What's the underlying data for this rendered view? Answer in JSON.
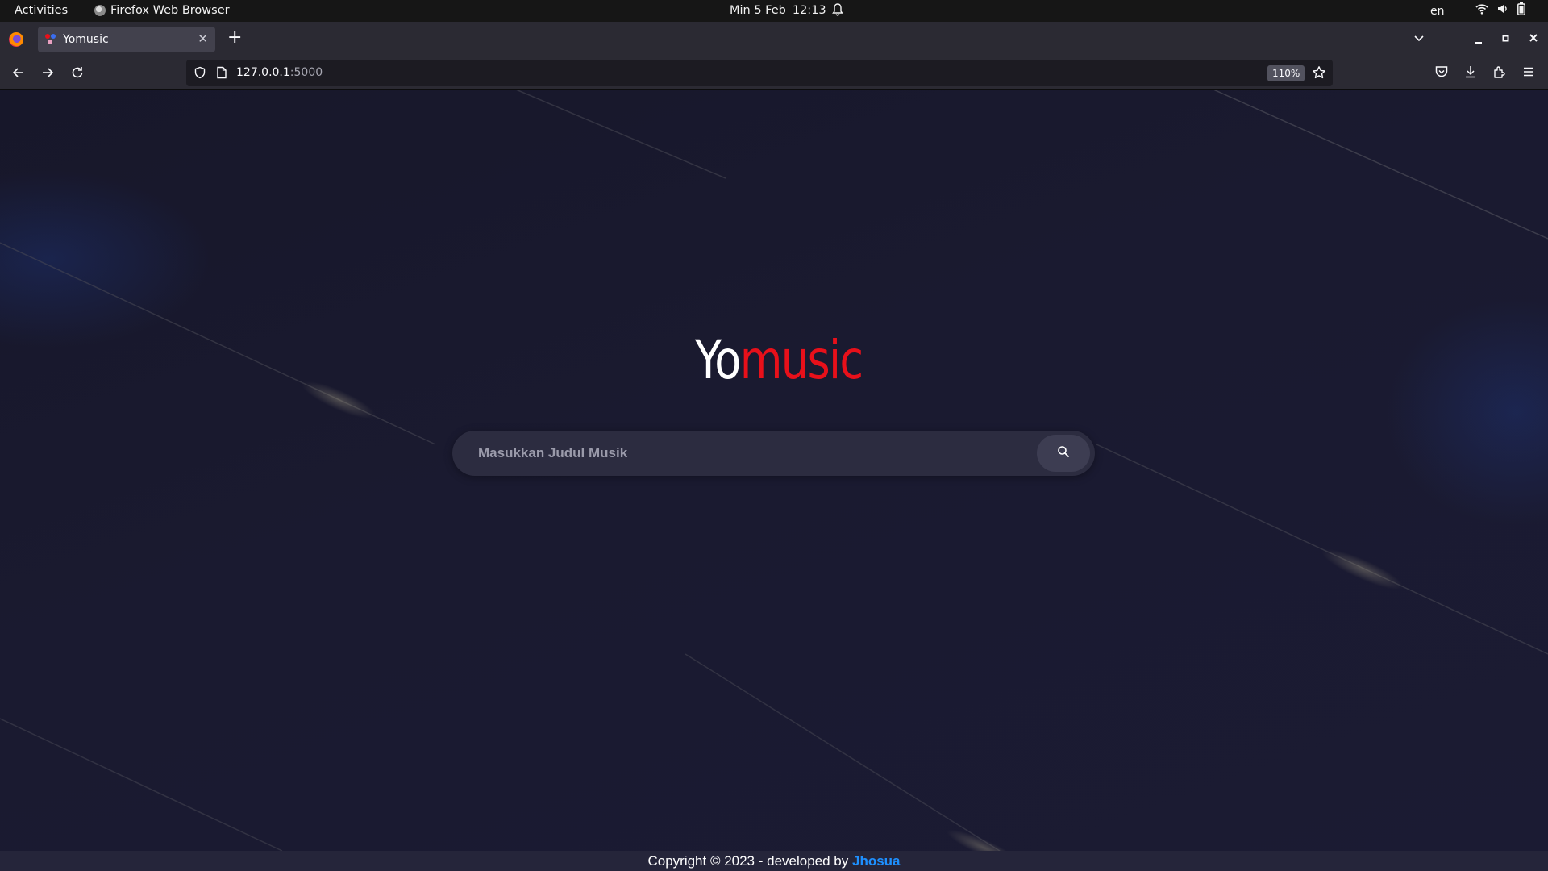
{
  "system_bar": {
    "activities": "Activities",
    "app_name": "Firefox Web Browser",
    "date": "Min 5 Feb",
    "time": "12:13",
    "language": "en"
  },
  "browser": {
    "tab_title": "Yomusic",
    "url_host": "127.0.0.1",
    "url_port": ":5000",
    "zoom": "110%"
  },
  "page": {
    "logo_yo": "Yo",
    "logo_music": "music",
    "search_placeholder": "Masukkan Judul Musik",
    "search_value": "",
    "footer_text": "Copyright © 2023 - developed by ",
    "footer_author": "Jhosua"
  },
  "colors": {
    "background": "#1a1a2e",
    "logo_yo": "#ffffff",
    "logo_music": "#e8101a",
    "link": "#1e90ff",
    "search_bg": "#2c2c40"
  },
  "icons": [
    "firefox-icon",
    "bell-icon",
    "wifi-icon",
    "volume-icon",
    "battery-icon",
    "back-icon",
    "forward-icon",
    "reload-icon",
    "shield-icon",
    "page-icon",
    "star-icon",
    "pocket-icon",
    "download-icon",
    "extensions-icon",
    "menu-icon",
    "search-icon"
  ]
}
